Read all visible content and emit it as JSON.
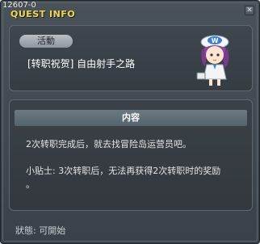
{
  "window": {
    "quest_id": "12607-0",
    "title": "QUEST INFO",
    "close_icon": "close-icon"
  },
  "event": {
    "badge": "活動",
    "quest_name": "[转职祝贺] 自由射手之路",
    "npc_icon": "npc-operator-icon"
  },
  "content": {
    "header": "内容",
    "line1": "2次转职完成后，就去找冒险岛运营员吧。",
    "line2": "小贴士: 3次转职后，无法再获得2次转职时的奖励",
    "line3": "。"
  },
  "status": {
    "text": "狀態: 可開始"
  },
  "colors": {
    "title": "#f0d850",
    "panel_bg": "#3a4148",
    "header_bg": "#6a7982"
  }
}
